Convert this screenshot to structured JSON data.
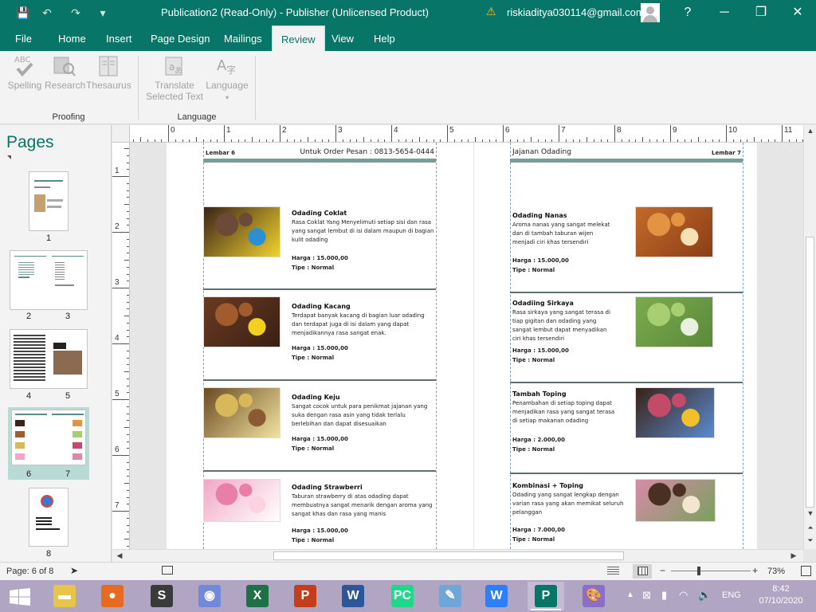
{
  "window": {
    "title": "Publication2 (Read-Only)  -  Publisher (Unlicensed Product)",
    "account": "riskiaditya030114@gmail.com",
    "help": "?",
    "controls": {
      "minimize": "─",
      "restore": "❐",
      "close": "✕"
    }
  },
  "quick_access": {
    "save": "💾",
    "undo": "↶",
    "redo": "↷",
    "customize": "▾"
  },
  "tabs": [
    {
      "label": "File",
      "active": false
    },
    {
      "label": "Home",
      "active": false
    },
    {
      "label": "Insert",
      "active": false
    },
    {
      "label": "Page Design",
      "active": false
    },
    {
      "label": "Mailings",
      "active": false
    },
    {
      "label": "Review",
      "active": true
    },
    {
      "label": "View",
      "active": false
    },
    {
      "label": "Help",
      "active": false
    }
  ],
  "ribbon": {
    "proofing": {
      "label": "Proofing",
      "spelling": "Spelling",
      "spelling_icon_text": "ABC",
      "research": "Research",
      "thesaurus": "Thesaurus"
    },
    "language": {
      "label": "Language",
      "translate_line1": "Translate",
      "translate_line2": "Selected Text",
      "language": "Language"
    }
  },
  "pages_panel": {
    "title": "Pages",
    "pages": [
      {
        "label": "1"
      },
      {
        "label": "2"
      },
      {
        "label": "3"
      },
      {
        "label": "4"
      },
      {
        "label": "5"
      },
      {
        "label": "6"
      },
      {
        "label": "7"
      },
      {
        "label": "8"
      }
    ]
  },
  "rulers": {
    "h_numbers": [
      "1",
      "0",
      "1",
      "2",
      "3",
      "4",
      "5",
      "6",
      "7",
      "8",
      "9",
      "10",
      "11"
    ],
    "v_numbers": [
      "1",
      "2",
      "3",
      "4",
      "5",
      "6",
      "7"
    ]
  },
  "spread": {
    "left_page": {
      "label": "Lembar 6",
      "header_right": "Untuk Order Pesan : 0813-5654-0444",
      "items": [
        {
          "name": "Odading Coklat",
          "desc": "Rasa Coklat Yang Menyelimuti setiap sisi dan rasa yang sangat lembut di isi dalam maupun di bagian kulit odading",
          "price": "Harga : 15.000,00",
          "type": "Tipe : Normal",
          "photo_colors": [
            "#3a2318",
            "#6b4a38",
            "#2e8fd0",
            "#f2d22e"
          ]
        },
        {
          "name": "Odading Kacang",
          "desc": "Terdapat banyak kacang di bagian luar odading dan terdapat juga di isi dalam yang dapat menjadikannya rasa sangat enak.",
          "price": "Harga : 15.000,00",
          "type": "Tipe : Normal",
          "photo_colors": [
            "#6a3a22",
            "#a25b2c",
            "#f2d020",
            "#3a2015"
          ]
        },
        {
          "name": "Odading Keju",
          "desc": "Sangat cocok untuk para penikmat jajanan yang suka dengan rasa asin yang tidak terlalu berlebihan dan dapat disesuaikan",
          "price": "Harga : 15.000,00",
          "type": "Tipe : Normal",
          "photo_colors": [
            "#6a4a22",
            "#d9b85a",
            "#8a5a30",
            "#f2e3a0"
          ]
        },
        {
          "name": "Odading Strawberri",
          "desc": "Taburan strawberry di atas odading dapat membuatnya sangat menarik dengan aroma yang sangat khas dan rasa yang manis",
          "price": "Harga : 15.000,00",
          "type": "Tipe : Normal",
          "photo_colors": [
            "#f2a7c4",
            "#e97fa8",
            "#fbd3e0",
            "#ffffff"
          ]
        }
      ]
    },
    "right_page": {
      "label": "Lembar 7",
      "header_left": "Jajanan Odading",
      "items": [
        {
          "name": "Odading Nanas",
          "desc": "Aroma nanas yang sangat melekat dan di tambah taburan wijen menjadi ciri khas tersendiri",
          "price": "Harga : 15.000,00",
          "type": "Tipe : Normal",
          "photo_colors": [
            "#c46a28",
            "#e39442",
            "#f6e1b5",
            "#8a3f18"
          ]
        },
        {
          "name": "Odadiing Sirkaya",
          "desc": "Rasa sirkaya yang sangat terasa di tiap gigitan dan odading yang sangat lembut dapat menyadikan ciri khas tersendiri",
          "price": "Harga : 15.000,00",
          "type": "Tipe : Normal",
          "photo_colors": [
            "#7caa4e",
            "#a7cf72",
            "#e8f0e0",
            "#5a8a3a"
          ]
        },
        {
          "name": "Tambah Toping",
          "desc": "Penambahan di setiap toping dapat menjadikan rasa yang sangat terasa di setiap makanan odading",
          "price": "Harga : 2.000,00",
          "type": "Tipe : Normal",
          "photo_colors": [
            "#3a2215",
            "#c44a6a",
            "#f2c12a",
            "#5a8ad0"
          ]
        },
        {
          "name": "Kombinasi + Toping",
          "desc": "Odading yang sangat lengkap dengan varian rasa yang akan memikat seluruh pelanggan",
          "price": "Harga : 7.000,00",
          "type": "Tipe : Normal",
          "photo_colors": [
            "#d88aa8",
            "#4a3020",
            "#f2e6d0",
            "#7aa060"
          ]
        }
      ]
    }
  },
  "status": {
    "page": "Page: 6 of 8",
    "zoom": "73%",
    "zoom_minus": "−",
    "zoom_plus": "+"
  },
  "taskbar": {
    "language": "ENG",
    "time": "8:42",
    "date": "07/10/2020",
    "apps": [
      {
        "name": "file-explorer",
        "color": "#e8c44a",
        "glyph": "▬",
        "active": false
      },
      {
        "name": "firefox",
        "color": "#e66a1f",
        "glyph": "●",
        "active": false
      },
      {
        "name": "sublime-text",
        "color": "#3a3a3a",
        "glyph": "S",
        "active": false
      },
      {
        "name": "discord",
        "color": "#7289da",
        "glyph": "◉",
        "active": false
      },
      {
        "name": "excel",
        "color": "#1e7145",
        "glyph": "X",
        "active": false
      },
      {
        "name": "powerpoint",
        "color": "#c43e1c",
        "glyph": "P",
        "active": false
      },
      {
        "name": "word",
        "color": "#2b579a",
        "glyph": "W",
        "active": false
      },
      {
        "name": "pycharm",
        "color": "#21d789",
        "glyph": "PC",
        "active": false
      },
      {
        "name": "notepad",
        "color": "#6fa6d8",
        "glyph": "✎",
        "active": false
      },
      {
        "name": "wps",
        "color": "#2d7ff9",
        "glyph": "W",
        "active": false
      },
      {
        "name": "publisher",
        "color": "#077568",
        "glyph": "P",
        "active": true
      },
      {
        "name": "paint",
        "color": "#8a6fc4",
        "glyph": "🎨",
        "active": false
      }
    ]
  }
}
